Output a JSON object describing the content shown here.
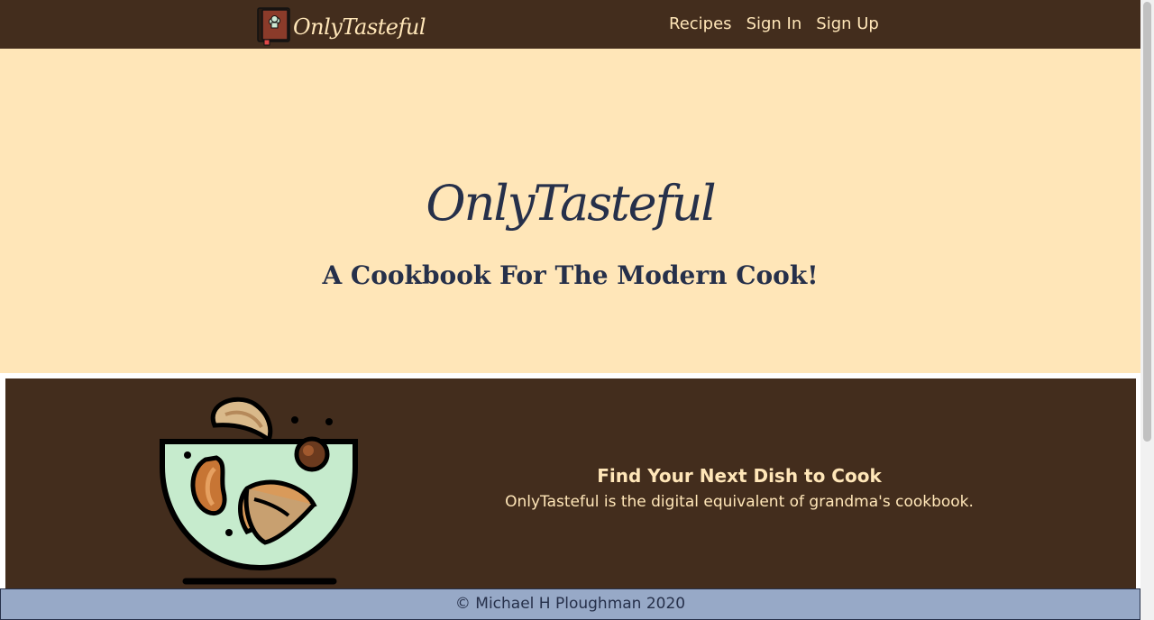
{
  "navbar": {
    "brand": "OnlyTasteful",
    "logo_icon": "cookbook-chef-hat-icon",
    "links": [
      "Recipes",
      "Sign In",
      "Sign Up"
    ]
  },
  "hero": {
    "title": "OnlyTasteful",
    "subtitle": "A Cookbook For The Modern Cook!"
  },
  "feature": {
    "illustration": "salad-bowl-icon",
    "heading": "Find Your Next Dish to Cook",
    "body": "OnlyTasteful is the digital equivalent of grandma's cookbook."
  },
  "footer": {
    "text": "© Michael H Ploughman 2020"
  },
  "colors": {
    "nav_bg": "#432d1d",
    "hero_bg": "#ffe6b8",
    "accent_text": "#ffe6b8",
    "dark_text": "#26304a",
    "footer_bg": "#97a9c7"
  }
}
